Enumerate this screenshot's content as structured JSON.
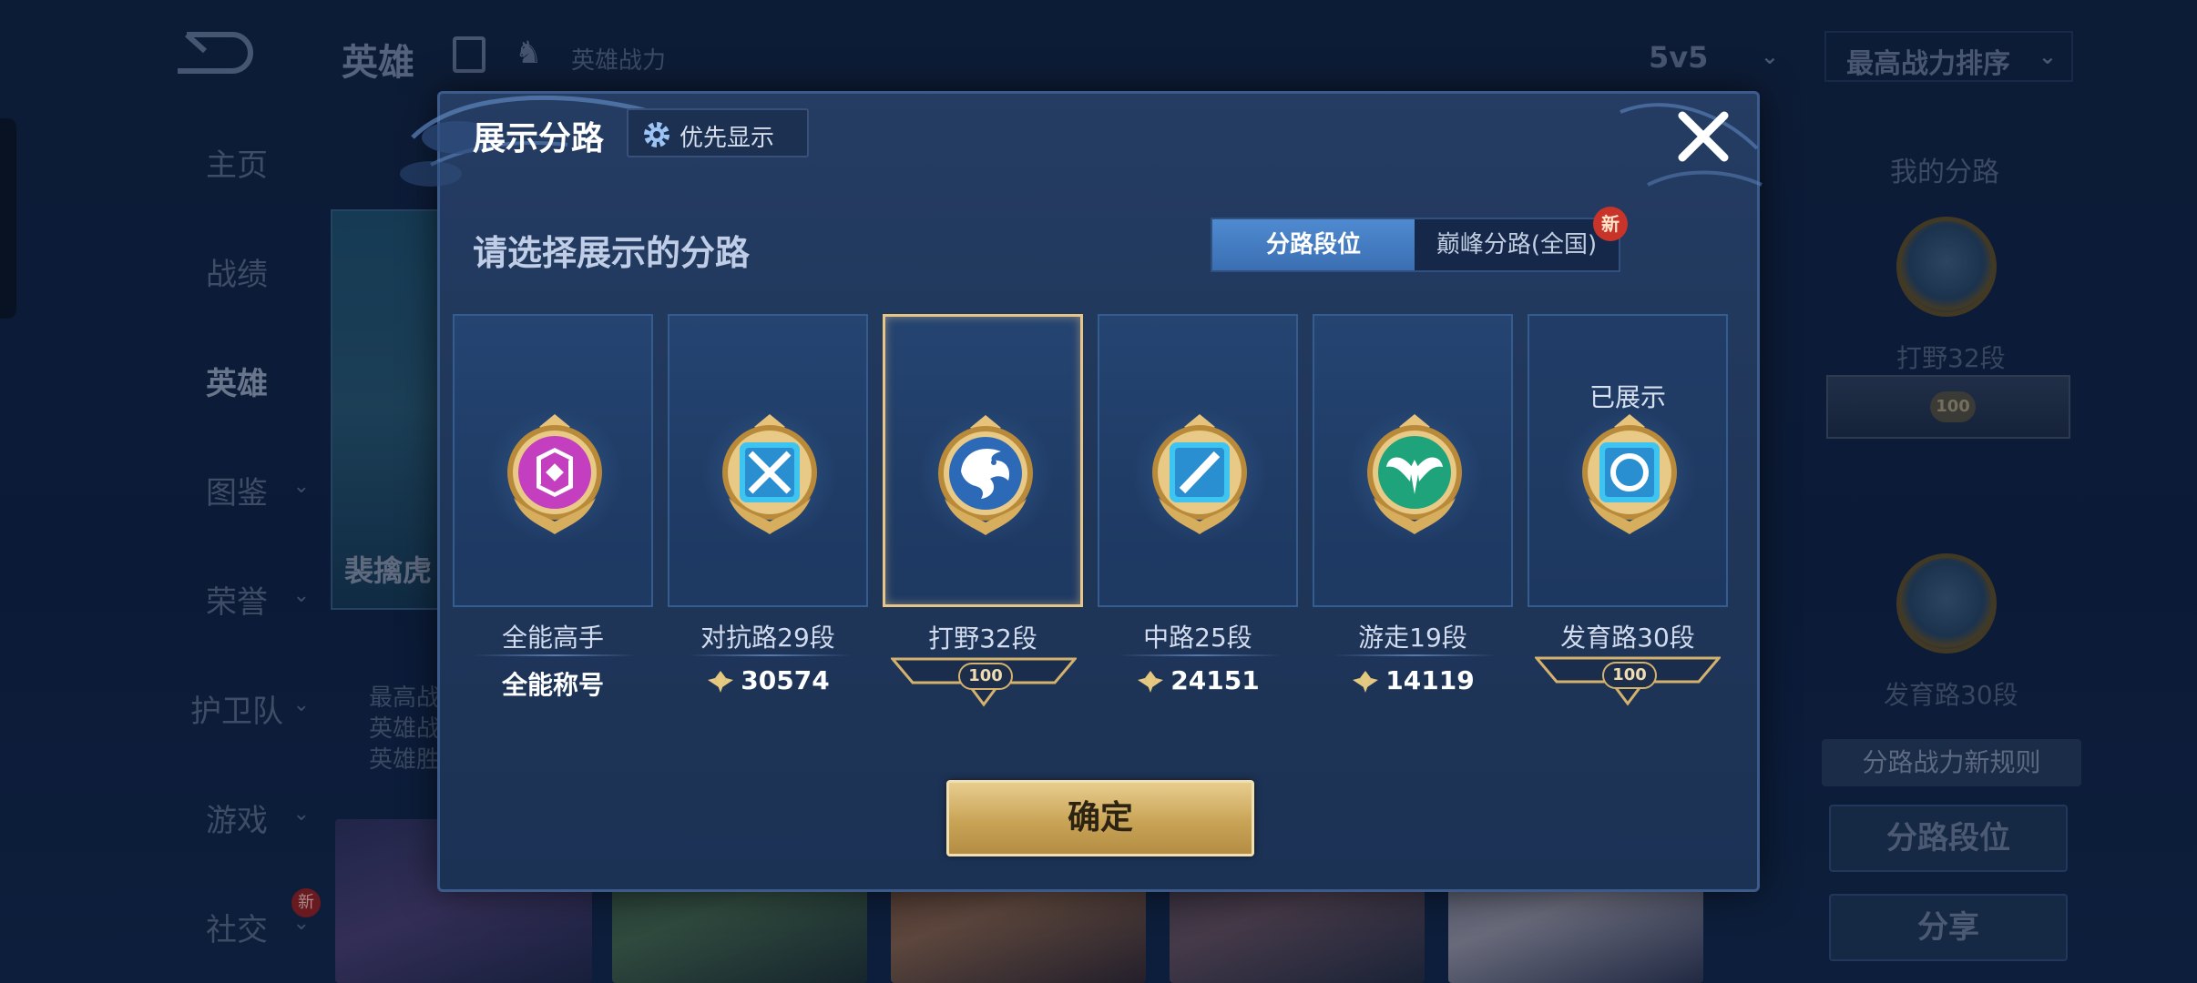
{
  "background": {
    "header": {
      "title": "英雄",
      "power_label": "英雄战力",
      "mode_select": "5v5",
      "sort_select": "最高战力排序"
    },
    "nav": [
      {
        "label": "主页",
        "chevron": false,
        "active": false
      },
      {
        "label": "战绩",
        "chevron": false,
        "active": false
      },
      {
        "label": "英雄",
        "chevron": false,
        "active": true
      },
      {
        "label": "图鉴",
        "chevron": true,
        "active": false
      },
      {
        "label": "荣誉",
        "chevron": true,
        "active": false
      },
      {
        "label": "护卫队",
        "chevron": true,
        "active": false
      },
      {
        "label": "游戏",
        "chevron": true,
        "active": false
      },
      {
        "label": "社交",
        "chevron": true,
        "active": false
      }
    ],
    "nav_new_badge": "新",
    "hero_name": "裴擒虎",
    "hero_info_lines": [
      "最高战",
      "英雄战",
      "英雄胜"
    ],
    "right_panel": {
      "title": "我的分路",
      "lane1_label": "打野32段",
      "lane1_level": "100",
      "lane2_label": "发育路30段",
      "rule_button": "分路战力新规则",
      "lane_rank_button": "分路段位",
      "share_button": "分享"
    }
  },
  "modal": {
    "title": "展示分路",
    "priority_button": "优先显示",
    "prompt": "请选择展示的分路",
    "tabs": [
      {
        "label": "分路段位",
        "active": true
      },
      {
        "label": "巅峰分路(全国)",
        "active": false
      }
    ],
    "tab_new_badge": "新",
    "cards": [
      {
        "name": "全能高手",
        "stat": "全能称号",
        "type": "title",
        "icon": "all-round-icon",
        "color": "#c43fc0"
      },
      {
        "name": "对抗路29段",
        "stat": "30574",
        "type": "power",
        "icon": "clash-lane-icon",
        "color": "#3dc4f0"
      },
      {
        "name": "打野32段",
        "stat": "100",
        "type": "level",
        "icon": "jungle-dragon-icon",
        "color": "#2c6ab8",
        "selected": true
      },
      {
        "name": "中路25段",
        "stat": "24151",
        "type": "power",
        "icon": "mid-lane-icon",
        "color": "#3dc4f0"
      },
      {
        "name": "游走19段",
        "stat": "14119",
        "type": "power",
        "icon": "roam-wings-icon",
        "color": "#1fa37a"
      },
      {
        "name": "发育路30段",
        "stat": "100",
        "type": "level",
        "icon": "farm-lane-icon",
        "color": "#3dc4f0",
        "shown": true
      }
    ],
    "shown_label": "已展示",
    "confirm_button": "确定"
  }
}
